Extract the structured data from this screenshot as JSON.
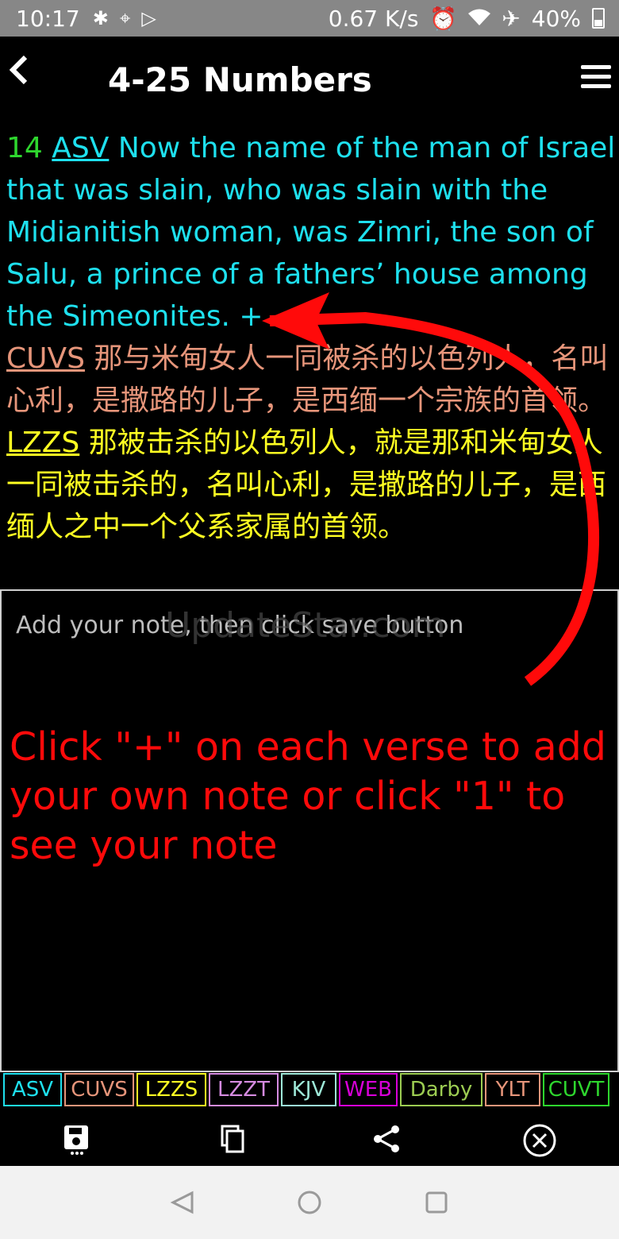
{
  "status_bar": {
    "time": "10:17",
    "speed": "0.67 K/s",
    "battery": "40%",
    "icons": [
      "notification-icon",
      "maps-icon",
      "play-icon",
      "alarm-icon",
      "wifi-icon",
      "airplane-icon",
      "battery-icon"
    ]
  },
  "header": {
    "back_label": "<",
    "title": "4-25 Numbers"
  },
  "verse": {
    "number": "14",
    "asv_tag": "ASV",
    "asv_text": "Now the name of the man of Israel that was slain, who was slain with the Midianitish woman, was Zimri, the son of Salu, a prince of a fathers’ house among the Simeonites.",
    "add_note": "+",
    "cuvs_tag": "CUVS",
    "cuvs_text": "那与米甸女人一同被杀的以色列人，名叫心利，是撒路的儿子，是西缅一个宗族的首领。",
    "lzzs_tag": "LZZS",
    "lzzs_text": "那被击杀的以色列人，就是那和米甸女人一同被击杀的，名叫心利，是撒路的儿子，是西缅人之中一个父系家属的首领。"
  },
  "note_editor": {
    "placeholder": "Add your note, then click save button",
    "watermark": "UpdateStar.com",
    "annotation": "Click \"+\" on each verse to add your own note or click \"1\" to see your note"
  },
  "version_tabs": [
    {
      "label": "ASV",
      "color": "#1ee0ee",
      "w": 74
    },
    {
      "label": "CUVS",
      "color": "#e6957a",
      "w": 88
    },
    {
      "label": "LZZS",
      "color": "#ffff22",
      "w": 88
    },
    {
      "label": "LZZT",
      "color": "#d58be0",
      "w": 88
    },
    {
      "label": "KJV",
      "color": "#9ee8d8",
      "w": 70
    },
    {
      "label": "WEB",
      "color": "#d800d8",
      "w": 74
    },
    {
      "label": "Darby",
      "color": "#9ccc52",
      "w": 104
    },
    {
      "label": "YLT",
      "color": "#e6957a",
      "w": 70
    },
    {
      "label": "CUVT",
      "color": "#2ed62e",
      "w": 84
    }
  ],
  "toolbar": {
    "items": [
      "save-icon",
      "copy-icon",
      "share-icon",
      "close-icon"
    ]
  },
  "colors": {
    "asv": "#1ee0ee",
    "cuvs": "#e6957a",
    "lzzs": "#ffff22",
    "verse_number": "#2ed62e",
    "annotation": "#ff0a0a"
  }
}
